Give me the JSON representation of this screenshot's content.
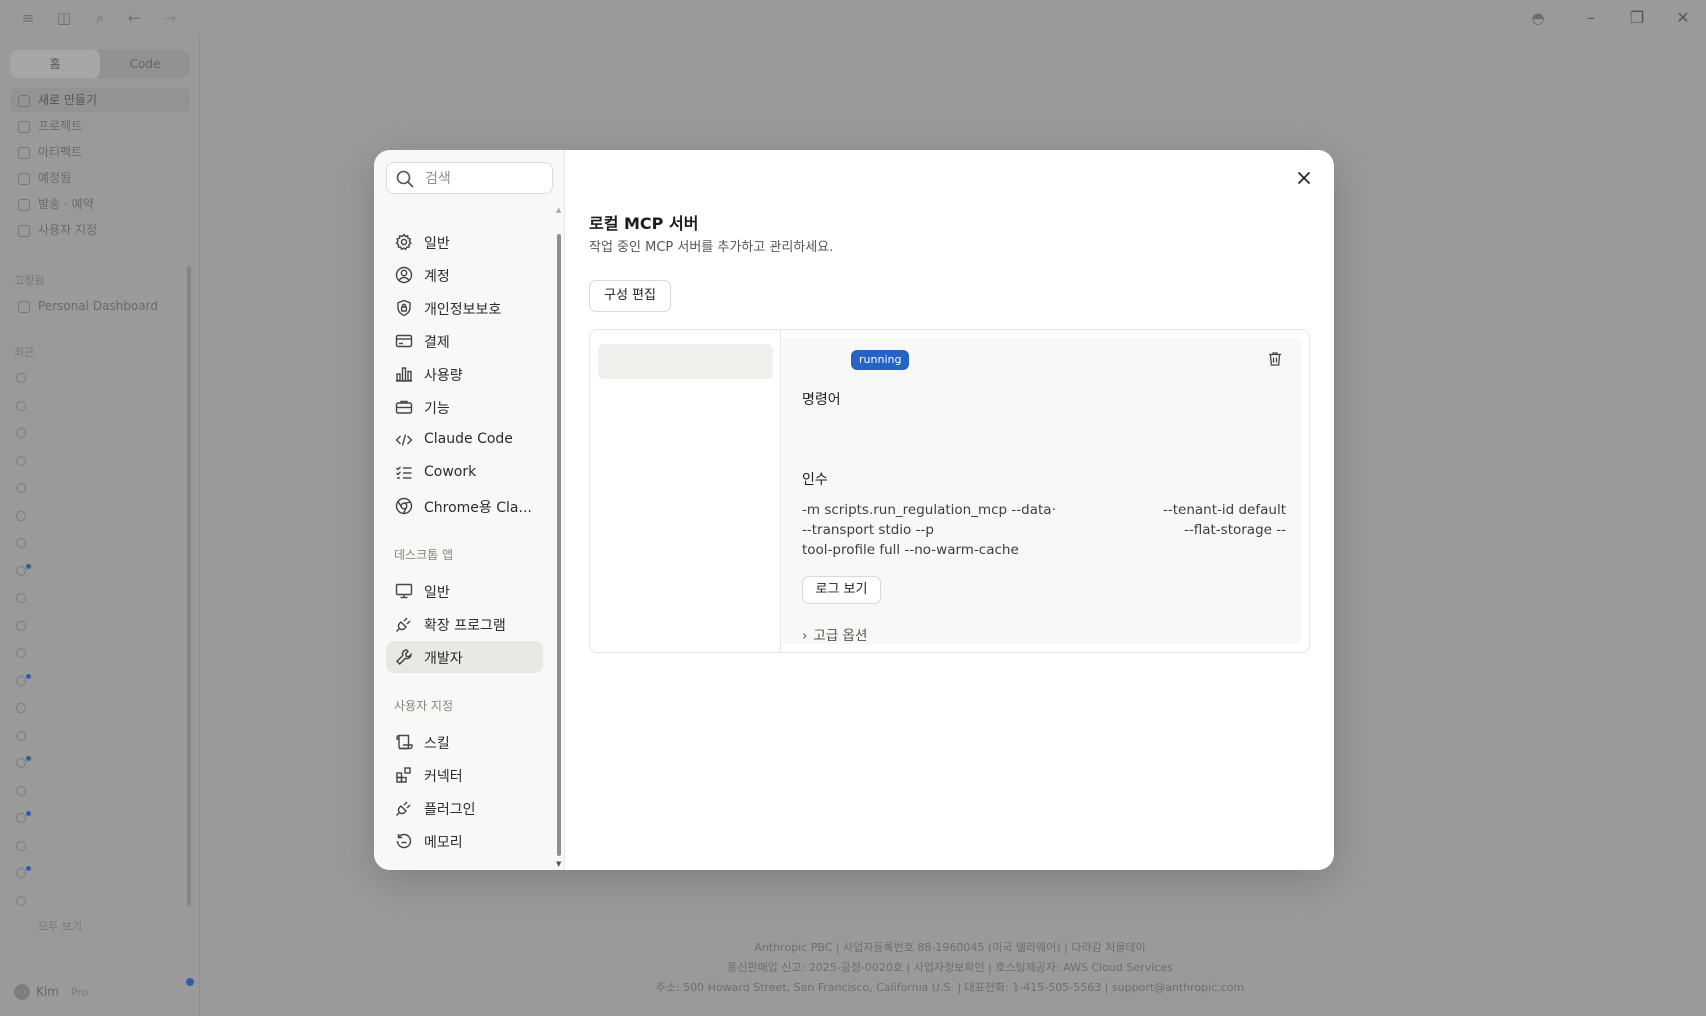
{
  "background": {
    "sidebar": {
      "seg_home": "홈",
      "seg_code": "Code",
      "nav": [
        "새로 만들기",
        "프로젝트",
        "아티팩트",
        "예정됨",
        "발송 · 예약",
        "사용자 지정"
      ],
      "pinned_label": "고정됨",
      "pinned_item": "Personal Dashboard",
      "recent_label": "최근",
      "more_label": "모두 보기",
      "user_name": "Kim",
      "user_plan": "Pro"
    },
    "footer": [
      "Anthropic PBC | 사업자등록번호 88-1960045 (미국 델라웨어) | 다라감 처을데이",
      "통신판매업 신고: 2025-공정-0020호 | 사업자정보확인 | 호스팅제공자: AWS Cloud Services",
      "주소: 500 Howard Street, San Francisco, California U.S. | 대표전화: 1-415-505-5563 | support@anthropic.com"
    ]
  },
  "modal": {
    "search_placeholder": "검색",
    "nav_main": [
      {
        "label": "일반",
        "icon": "gear-icon"
      },
      {
        "label": "계정",
        "icon": "user-circle-icon"
      },
      {
        "label": "개인정보보호",
        "icon": "shield-icon"
      },
      {
        "label": "결제",
        "icon": "credit-card-icon"
      },
      {
        "label": "사용량",
        "icon": "bar-chart-icon"
      },
      {
        "label": "기능",
        "icon": "briefcase-icon"
      },
      {
        "label": "Claude Code",
        "icon": "code-icon"
      },
      {
        "label": "Cowork",
        "icon": "checklist-icon"
      },
      {
        "label": "Chrome용 Cla...",
        "icon": "globe-icon"
      }
    ],
    "section_desktop": "데스크톱 앱",
    "nav_desktop": [
      {
        "label": "일반",
        "icon": "monitor-icon"
      },
      {
        "label": "확장 프로그램",
        "icon": "plug-icon"
      },
      {
        "label": "개발자",
        "icon": "wrench-icon"
      }
    ],
    "section_custom": "사용자 지정",
    "nav_custom": [
      {
        "label": "스킬",
        "icon": "scroll-icon"
      },
      {
        "label": "커넥터",
        "icon": "blocks-icon"
      },
      {
        "label": "플러그인",
        "icon": "plug-icon"
      },
      {
        "label": "메모리",
        "icon": "history-icon"
      }
    ],
    "title": "로컬 MCP 서버",
    "subtitle": "작업 중인 MCP 서버를 추가하고 관리하세요.",
    "edit_config": "구성 편집",
    "server": {
      "status": "running",
      "command_label": "명령어",
      "args_label": "인수",
      "args_lines": [
        {
          "left": "-m scripts.run_regulation_mcp --data·",
          "right": "--tenant-id default"
        },
        {
          "left": "--transport stdio --p",
          "right": "--flat-storage --"
        },
        {
          "left": "tool-profile full --no-warm-cache",
          "right": ""
        }
      ],
      "view_logs": "로그 보기",
      "advanced": "고급 옵션"
    },
    "colors": {
      "accent": "#2563c4",
      "active_nav": "#e8e8e4"
    }
  }
}
